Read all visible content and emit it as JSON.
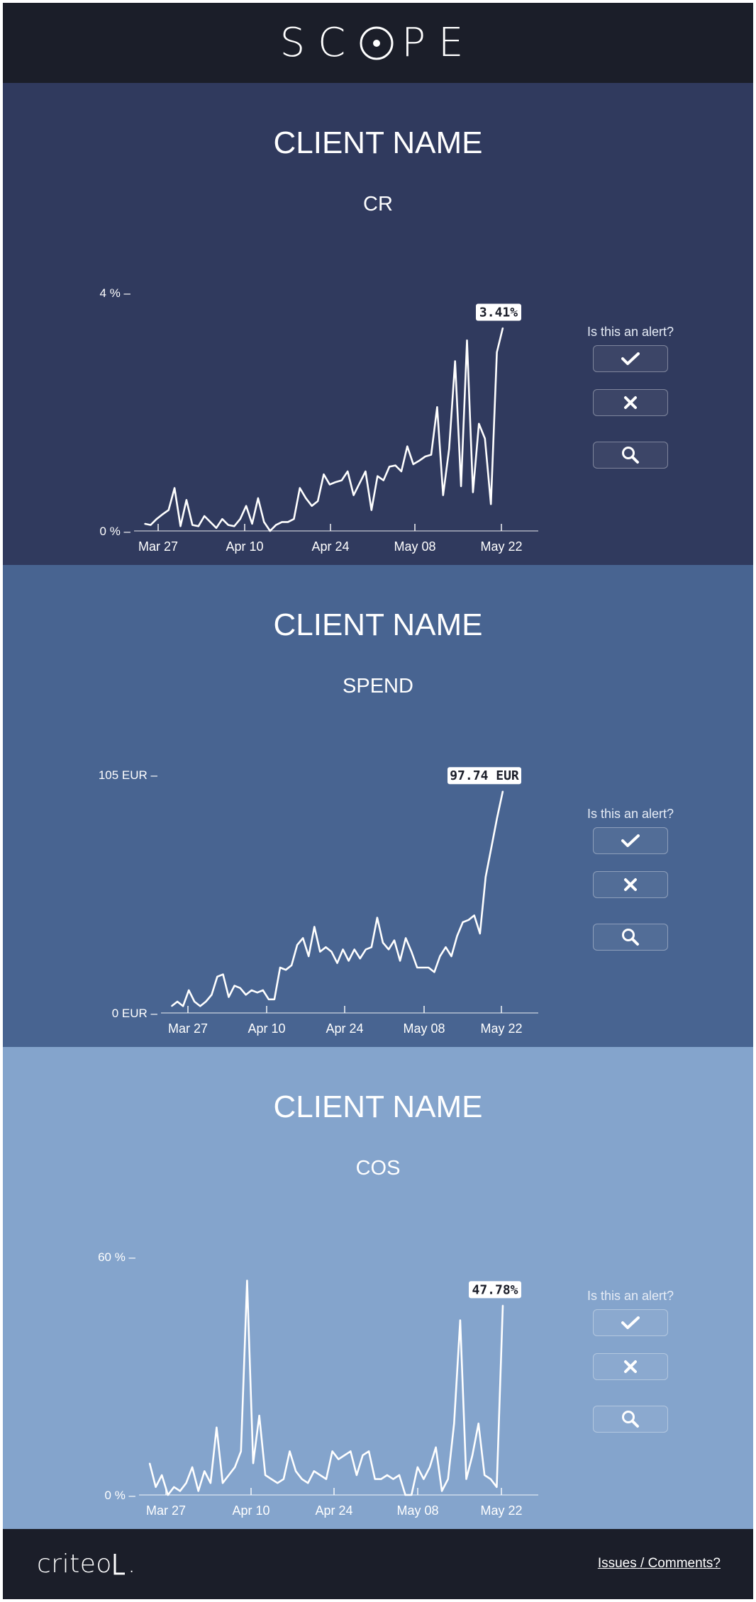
{
  "header": {
    "logo_text": "SCOPE"
  },
  "panels": [
    {
      "client": "CLIENT NAME",
      "metric": "CR",
      "y_top_label": "4 % –",
      "y_bottom_label": "0 % –",
      "tooltip": "3.41%",
      "alert_question": "Is this an alert?",
      "colors": {
        "background": "#303a5e",
        "line": "#ffffff"
      },
      "chart_data": {
        "type": "line",
        "title": "CR",
        "ylim": [
          0,
          4
        ],
        "y_unit": "%",
        "x_tick_labels": [
          "Mar 27",
          "Apr 10",
          "Apr 24",
          "May 08",
          "May 22"
        ],
        "last_value_label": "3.41%",
        "series": [
          {
            "values": [
              0.12,
              0.1,
              0.2,
              0.28,
              0.35,
              0.72,
              0.08,
              0.52,
              0.1,
              0.08,
              0.25,
              0.15,
              0.05,
              0.2,
              0.1,
              0.08,
              0.2,
              0.42,
              0.12,
              0.55,
              0.15,
              0.0,
              0.1,
              0.15,
              0.15,
              0.2,
              0.72,
              0.55,
              0.42,
              0.5,
              0.95,
              0.78,
              0.82,
              0.85,
              1.0,
              0.6,
              0.8,
              1.0,
              0.35,
              0.92,
              0.85,
              1.08,
              1.1,
              1.0,
              1.42,
              1.12,
              1.18,
              1.25,
              1.28,
              2.08,
              0.6,
              1.38,
              2.85,
              0.75,
              3.2,
              0.65,
              1.8,
              1.55,
              0.45,
              3.0,
              3.41
            ]
          }
        ]
      }
    },
    {
      "client": "CLIENT NAME",
      "metric": "SPEND",
      "y_top_label": "105 EUR –",
      "y_bottom_label": "0 EUR –",
      "tooltip": "97.74 EUR",
      "alert_question": "Is this an alert?",
      "colors": {
        "background": "#486491",
        "line": "#ffffff"
      },
      "chart_data": {
        "type": "line",
        "title": "SPEND",
        "ylim": [
          0,
          105
        ],
        "y_unit": "EUR",
        "x_tick_labels": [
          "Mar 27",
          "Apr 10",
          "Apr 24",
          "May 08",
          "May 22"
        ],
        "last_value_label": "97.74 EUR",
        "series": [
          {
            "values": [
              3,
              5,
              3,
              10,
              5,
              3,
              5,
              8,
              16,
              17,
              7,
              12,
              11,
              8,
              10,
              9,
              10,
              6,
              6,
              20,
              19,
              21,
              30,
              33,
              25,
              38,
              27,
              29,
              27,
              22,
              28,
              23,
              28,
              24,
              28,
              29,
              42,
              31,
              28,
              32,
              23,
              33,
              27,
              20,
              20,
              20,
              18,
              25,
              29,
              25,
              34,
              40,
              41,
              43,
              35,
              60,
              73,
              86,
              97.74
            ]
          }
        ]
      }
    },
    {
      "client": "CLIENT NAME",
      "metric": "COS",
      "y_top_label": "60 % –",
      "y_bottom_label": "0 % –",
      "tooltip": "47.78%",
      "alert_question": "Is this an alert?",
      "colors": {
        "background": "#84a4cc",
        "line": "#ffffff"
      },
      "chart_data": {
        "type": "line",
        "title": "COS",
        "ylim": [
          0,
          60
        ],
        "y_unit": "%",
        "x_tick_labels": [
          "Mar 27",
          "Apr 10",
          "Apr 24",
          "May 08",
          "May 22"
        ],
        "last_value_label": "47.78%",
        "series": [
          {
            "values": [
              8,
              2,
              5,
              0,
              2,
              1,
              3,
              7,
              1,
              6,
              3,
              17,
              3,
              5,
              7,
              11,
              54,
              8,
              20,
              5,
              4,
              3,
              4,
              11,
              6,
              4,
              3,
              6,
              5,
              4,
              11,
              9,
              10,
              11,
              5,
              10,
              11,
              4,
              4,
              5,
              4,
              5,
              0,
              0,
              7,
              4,
              7,
              12,
              1,
              4,
              18,
              44,
              4,
              10,
              18,
              5,
              4,
              2,
              47.78
            ]
          }
        ]
      }
    }
  ],
  "buttons": {
    "yes_icon": "checkmark-icon",
    "no_icon": "x-icon",
    "zoom_icon": "magnifier-icon"
  },
  "footer": {
    "brand": "criteo",
    "issues_link": "Issues / Comments?"
  }
}
